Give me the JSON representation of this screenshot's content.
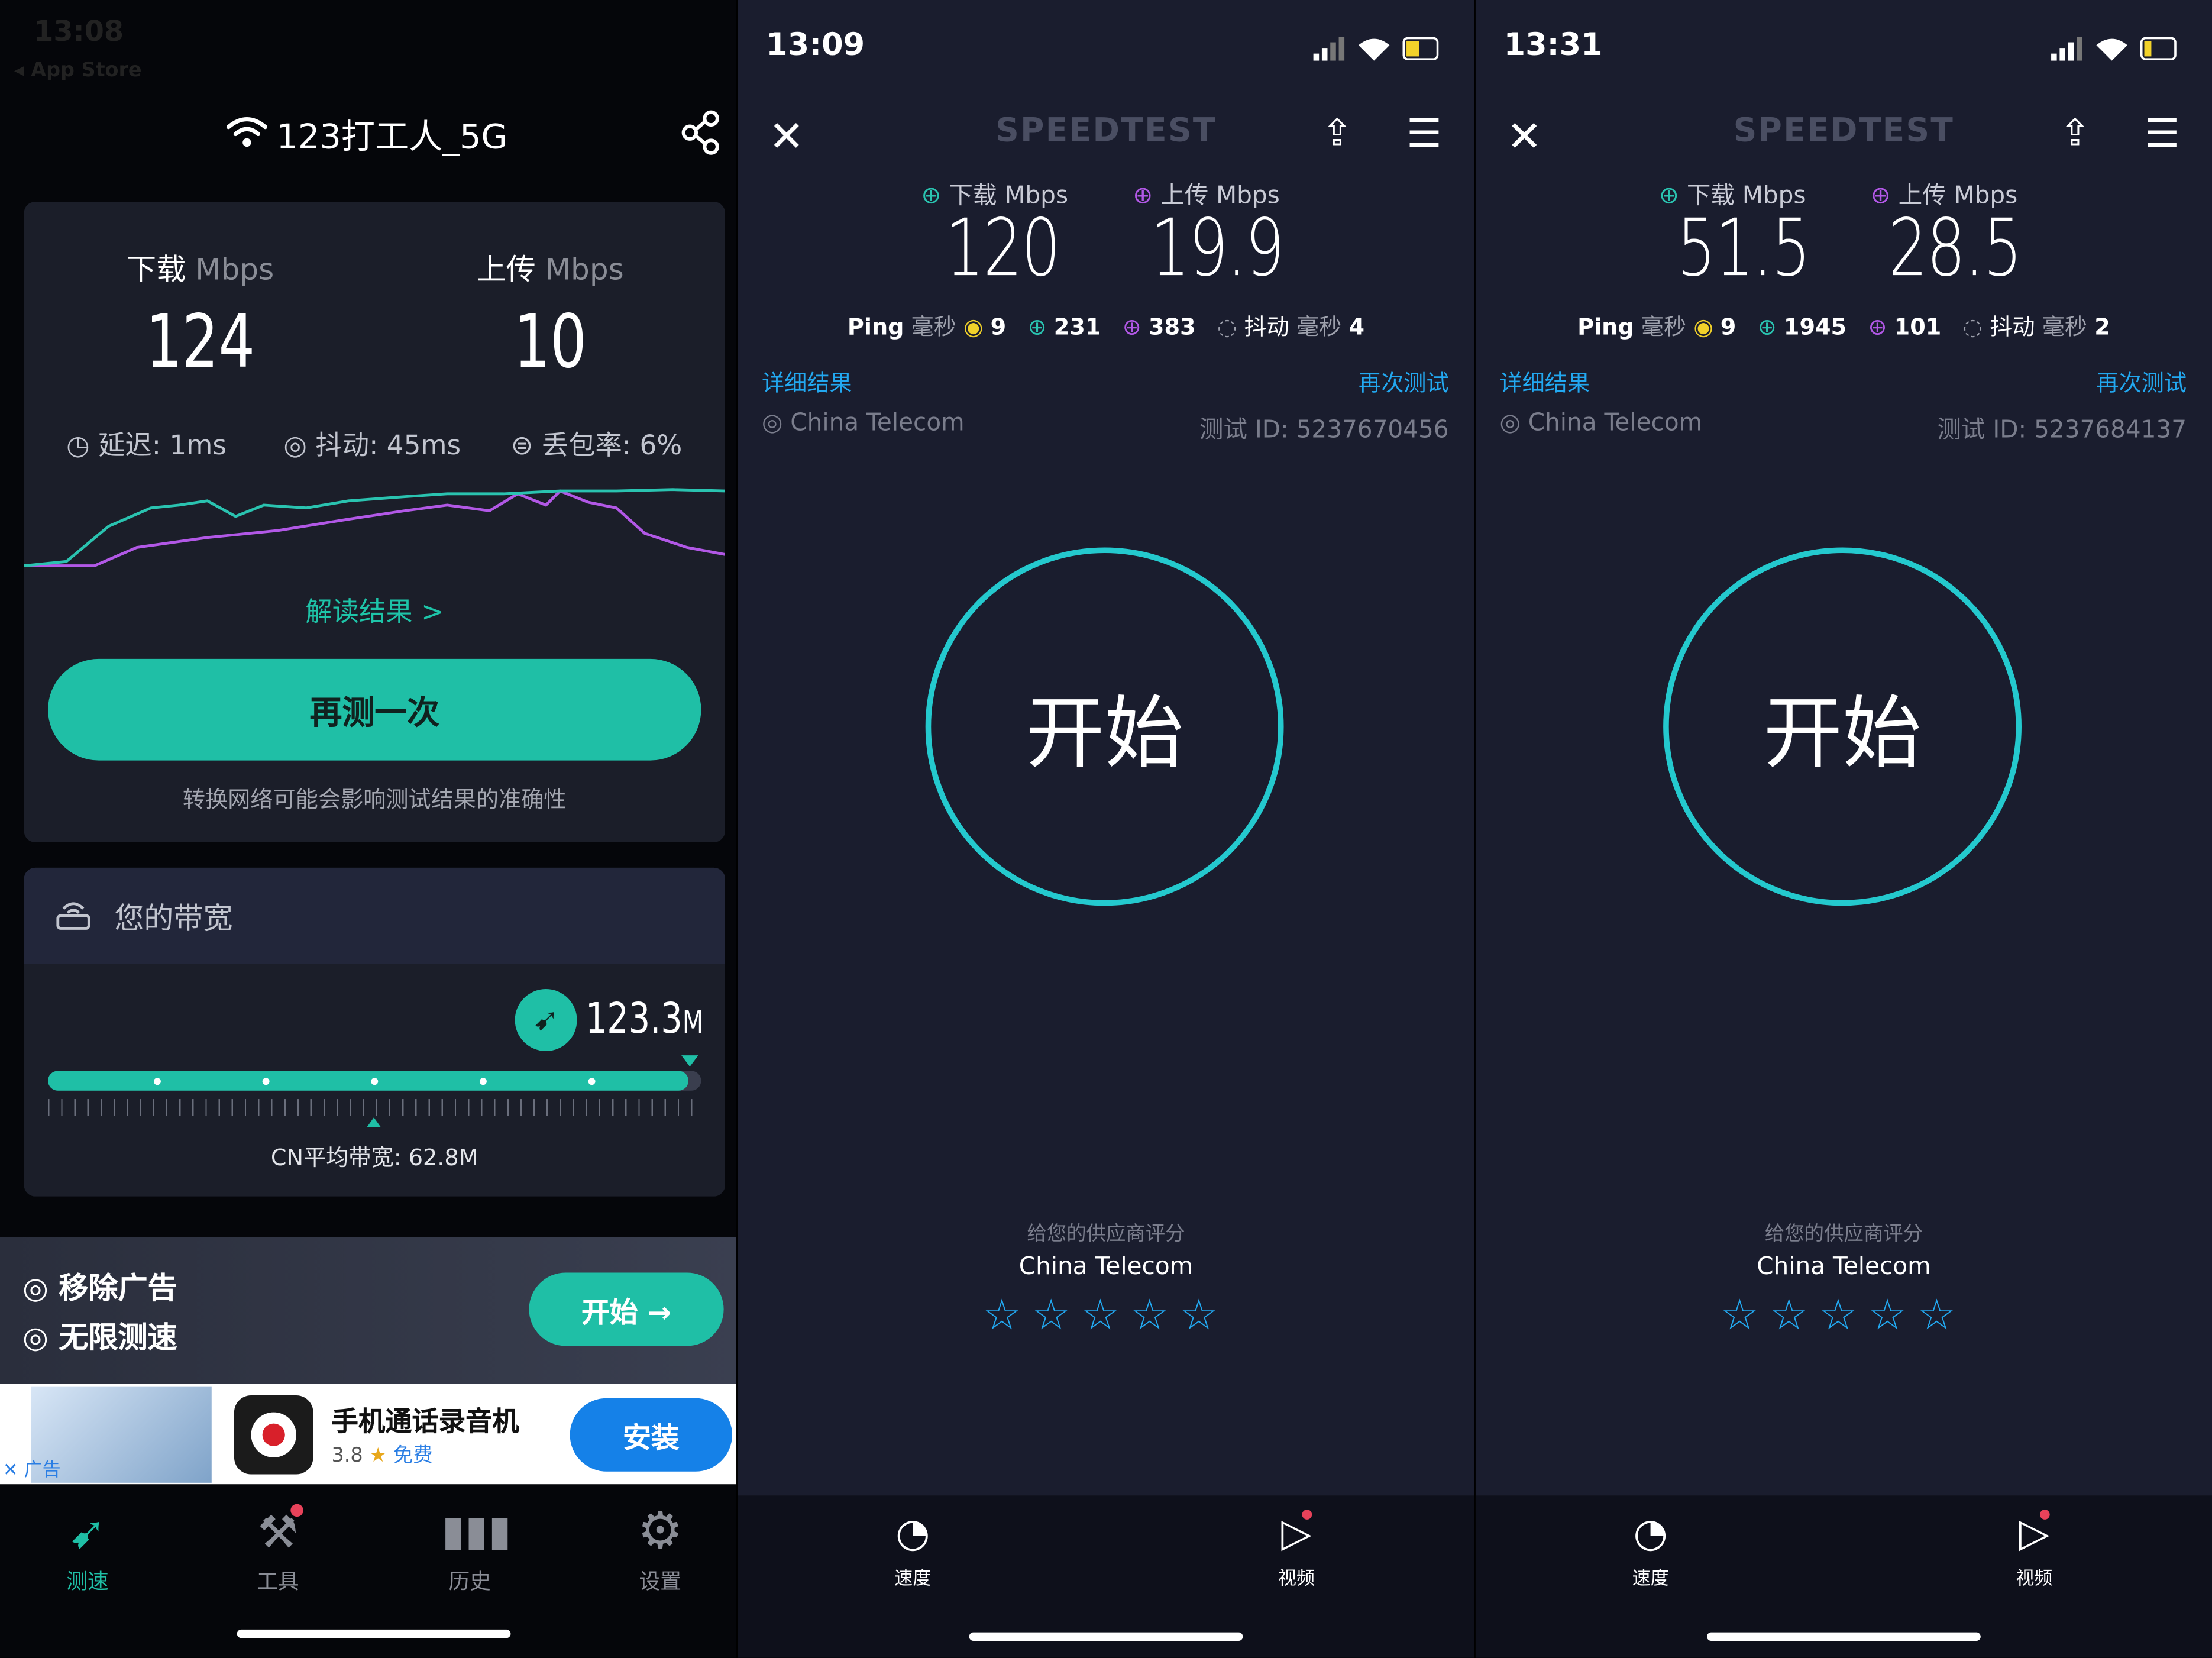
{
  "panel1": {
    "status_time": "13:08",
    "back_app": "◂ App Store",
    "network_name": "123打工人_5G",
    "download_label": "下载",
    "upload_label": "上传",
    "unit": "Mbps",
    "download_value": "124",
    "upload_value": "10",
    "latency": "延迟: 1ms",
    "jitter": "抖动: 45ms",
    "packet_loss": "丢包率: 6%",
    "interpret_link": "解读结果 >",
    "retest_button": "再测一次",
    "network_note": "转换网络可能会影响测试结果的准确性",
    "bandwidth_title": "您的带宽",
    "bandwidth_value": "123.3",
    "bandwidth_unit": "M",
    "bandwidth_level": 0.98,
    "cn_average": "CN平均带宽: 62.8M",
    "promo_items": [
      "移除广告",
      "无限测速"
    ],
    "promo_button": "开始 →",
    "ad_label": "广告",
    "ad_app_name": "手机通话录音机",
    "ad_rating": "3.8",
    "ad_price": "免费",
    "ad_install": "安装",
    "tabs": [
      "测速",
      "工具",
      "历史",
      "设置"
    ],
    "active_tab": "测速"
  },
  "panel2": {
    "status_time": "13:09",
    "logo": "SPEEDTEST",
    "download_label": "下载 Mbps",
    "upload_label": "上传 Mbps",
    "download_value": "120",
    "upload_value": "19.9",
    "ping_label": "Ping",
    "ms_label": "毫秒",
    "ping_value": "9",
    "ping_down": "231",
    "ping_up": "383",
    "jitter_label": "抖动",
    "jitter_value": "4",
    "details_link": "详细结果",
    "retest_link": "再次测试",
    "provider": "China Telecom",
    "test_id": "测试 ID: 5237670456",
    "start_label": "开始",
    "rate_label": "给您的供应商评分",
    "rate_provider": "China Telecom",
    "tabs": [
      "速度",
      "视频"
    ]
  },
  "panel3": {
    "status_time": "13:31",
    "logo": "SPEEDTEST",
    "download_label": "下载 Mbps",
    "upload_label": "上传 Mbps",
    "download_value": "51.5",
    "upload_value": "28.5",
    "ping_label": "Ping",
    "ms_label": "毫秒",
    "ping_value": "9",
    "ping_down": "1945",
    "ping_up": "101",
    "jitter_label": "抖动",
    "jitter_value": "2",
    "details_link": "详细结果",
    "retest_link": "再次测试",
    "provider": "China Telecom",
    "test_id": "测试 ID: 5237684137",
    "start_label": "开始",
    "rate_label": "给您的供应商评分",
    "rate_provider": "China Telecom",
    "tabs": [
      "速度",
      "视频"
    ]
  },
  "colors": {
    "teal": "#1fbfa6",
    "speedtest_cyan": "#24c9ce",
    "link_blue": "#22a8f0",
    "download_line": "#2ac3b0",
    "upload_line": "#b258e6"
  }
}
